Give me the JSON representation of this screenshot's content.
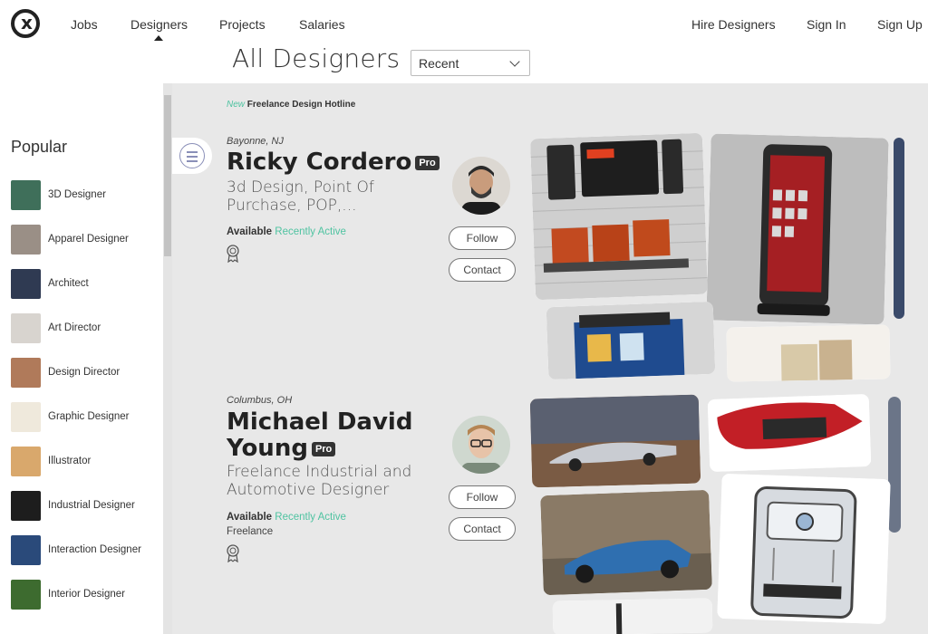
{
  "nav": {
    "logo_glyph": "x",
    "links": [
      "Jobs",
      "Designers",
      "Projects",
      "Salaries"
    ],
    "right_links": [
      "Hire Designers",
      "Sign In",
      "Sign Up"
    ],
    "active": "Designers"
  },
  "header": {
    "title": "All Designers",
    "sort_value": "Recent"
  },
  "sidebar": {
    "title": "Popular",
    "items": [
      {
        "label": "3D Designer",
        "color": "#3f6f5a"
      },
      {
        "label": "Apparel Designer",
        "color": "#9a8f86"
      },
      {
        "label": "Architect",
        "color": "#2f3a52"
      },
      {
        "label": "Art Director",
        "color": "#d8d4cf"
      },
      {
        "label": "Design Director",
        "color": "#b07a5a"
      },
      {
        "label": "Graphic Designer",
        "color": "#efe9dc"
      },
      {
        "label": "Illustrator",
        "color": "#d9a86c"
      },
      {
        "label": "Industrial Designer",
        "color": "#1d1d1d"
      },
      {
        "label": "Interaction Designer",
        "color": "#2a4a7a"
      },
      {
        "label": "Interior Designer",
        "color": "#3d6b2f"
      }
    ]
  },
  "main": {
    "hotline_new": "New",
    "hotline_text": "Freelance Design Hotline",
    "designers": [
      {
        "location": "Bayonne, NJ",
        "name": "Ricky Cordero",
        "pro": "Pro",
        "description_line1": "3d Design, Point Of",
        "description_line2": "Purchase, POP,...",
        "available": "Available",
        "activity": "Recently Active",
        "follow": "Follow",
        "contact": "Contact"
      },
      {
        "location": "Columbus, OH",
        "name_line1": "Michael David",
        "name_line2": "Young",
        "pro": "Pro",
        "description_line1": "Freelance Industrial and",
        "description_line2": "Automotive Designer",
        "available": "Available",
        "activity": "Recently Active",
        "status": "Freelance",
        "follow": "Follow",
        "contact": "Contact"
      }
    ]
  },
  "colors": {
    "accent": "#4fc3a1",
    "main_bg": "#e8e8e8",
    "pro_badge": "#333333"
  }
}
